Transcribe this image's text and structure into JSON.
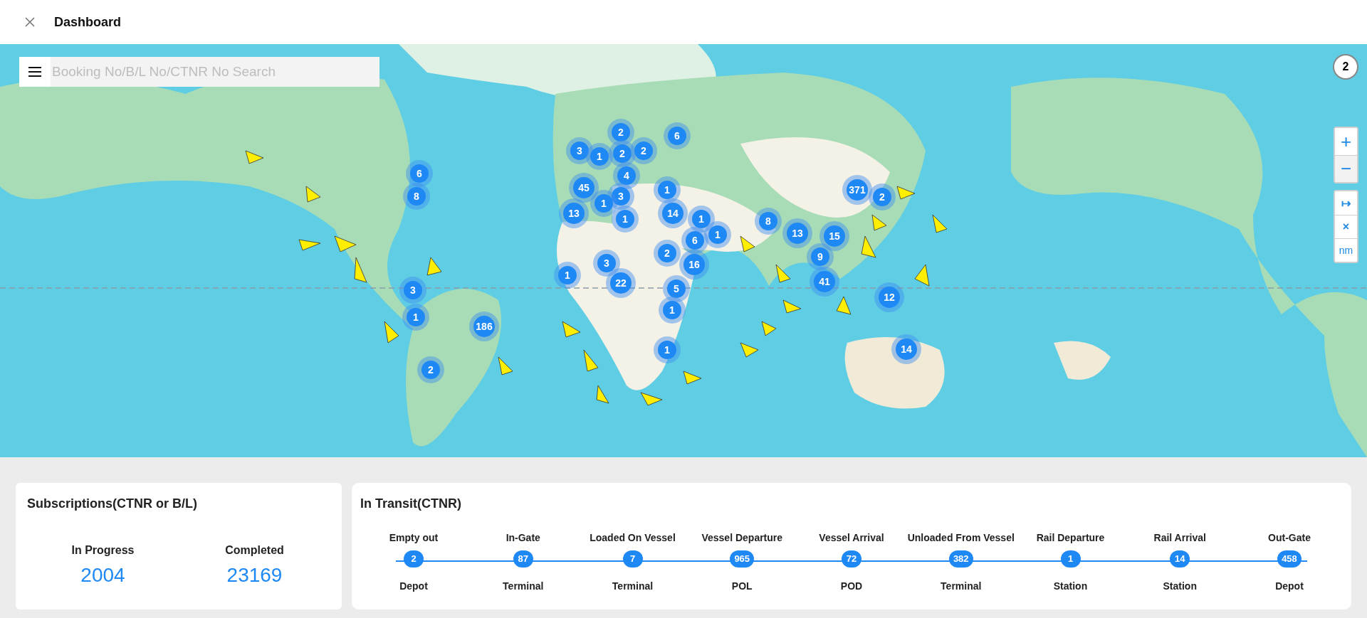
{
  "header": {
    "title": "Dashboard"
  },
  "search": {
    "placeholder": "Booking No/B/L No/CTNR No Search"
  },
  "map": {
    "kind": "picture",
    "badge": "2",
    "zoom_buttons": [
      "+",
      "−"
    ],
    "tool_buttons": [
      "↦",
      "×",
      "nm"
    ],
    "clusters": [
      {
        "count": "6"
      },
      {
        "count": "8"
      },
      {
        "count": "2"
      },
      {
        "count": "3"
      },
      {
        "count": "1"
      },
      {
        "count": "2"
      },
      {
        "count": "2"
      },
      {
        "count": "6"
      },
      {
        "count": "4"
      },
      {
        "count": "3"
      },
      {
        "count": "45"
      },
      {
        "count": "1"
      },
      {
        "count": "13"
      },
      {
        "count": "1"
      },
      {
        "count": "1"
      },
      {
        "count": "14"
      },
      {
        "count": "1"
      },
      {
        "count": "6"
      },
      {
        "count": "1"
      },
      {
        "count": "2"
      },
      {
        "count": "16"
      },
      {
        "count": "8"
      },
      {
        "count": "13"
      },
      {
        "count": "371"
      },
      {
        "count": "2"
      },
      {
        "count": "15"
      },
      {
        "count": "9"
      },
      {
        "count": "41"
      },
      {
        "count": "12"
      },
      {
        "count": "1"
      },
      {
        "count": "3"
      },
      {
        "count": "22"
      },
      {
        "count": "5"
      },
      {
        "count": "1"
      },
      {
        "count": "3"
      },
      {
        "count": "1"
      },
      {
        "count": "186"
      },
      {
        "count": "2"
      },
      {
        "count": "1"
      },
      {
        "count": "14"
      }
    ]
  },
  "subscriptions": {
    "title": "Subscriptions(CTNR or B/L)",
    "stats": [
      {
        "label": "In Progress",
        "value": "2004"
      },
      {
        "label": "Completed",
        "value": "23169"
      }
    ]
  },
  "transit": {
    "title": "In Transit(CTNR)",
    "stages": [
      {
        "label": "Empty out",
        "count": "2",
        "place": "Depot"
      },
      {
        "label": "In-Gate",
        "count": "87",
        "place": "Terminal"
      },
      {
        "label": "Loaded On Vessel",
        "count": "7",
        "place": "Terminal"
      },
      {
        "label": "Vessel Departure",
        "count": "965",
        "place": "POL"
      },
      {
        "label": "Vessel Arrival",
        "count": "72",
        "place": "POD"
      },
      {
        "label": "Unloaded From Vessel",
        "count": "382",
        "place": "Terminal"
      },
      {
        "label": "Rail Departure",
        "count": "1",
        "place": "Station"
      },
      {
        "label": "Rail Arrival",
        "count": "14",
        "place": "Station"
      },
      {
        "label": "Out-Gate",
        "count": "458",
        "place": "Depot"
      }
    ]
  }
}
